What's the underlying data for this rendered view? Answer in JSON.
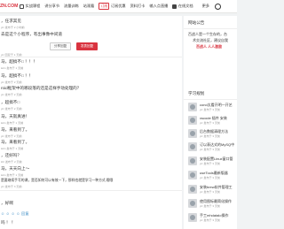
{
  "topbar": {
    "logo": "ZN.COM",
    "items": [
      {
        "label": "实战课程",
        "icon": "play-icon"
      },
      {
        "label": "讲分享节"
      },
      {
        "label": "流量训练"
      },
      {
        "label": "站观看"
      },
      {
        "label": "订阅优惠",
        "badge": "订阅"
      },
      {
        "label": "资料打卡"
      },
      {
        "label": "输入点直播"
      },
      {
        "label": "在线文档"
      }
    ],
    "more": "更多"
  },
  "left_items": [
    {
      "title": "，任求其见",
      "meta": "yiz 发布于 2 小时前"
    },
    {
      "title": "去是这个小程序，有出事像中间道",
      "meta": ""
    },
    {
      "title": "",
      "meta": "yiz 回复于 1 天前"
    },
    {
      "title": "马，超搞不□ ！！！",
      "meta": "lelin 发布于 1 天前"
    },
    {
      "title": "马，超搞不□ ！！",
      "meta": "yiz 发布于 2 天前"
    },
    {
      "title": "roid框架中的哪段落的还是这样手动处理的？",
      "meta": "yiz 发布于 2 天前"
    },
    {
      "title": "，超搞不□",
      "meta": "yiz 发布于 2 天前"
    },
    {
      "title": "马，天就真进！",
      "meta": "lelin 发布于 1 天前"
    },
    {
      "title": "马，来看到了。",
      "meta": "yiz 发布于 2 天前"
    },
    {
      "title": "马，来看到了。",
      "meta": "lelin 发布于 1 天前"
    },
    {
      "title": "，还好吗？",
      "meta": "ldz 发布于 2 天前"
    },
    {
      "title": "马，天天向上～",
      "meta": "lelin 发布于 1 天前"
    },
    {
      "title": "是要继续手写的课，是否如何可以有效一下，那样也就是学习一种方式,哦哦",
      "meta": "yiz 发布于 3 天前"
    },
    {
      "title": "，好啊",
      "meta": ""
    },
    {
      "title": "吗 ！ ！",
      "meta": ""
    }
  ],
  "buttons": {
    "share": "分享回复",
    "submit": "发表回复"
  },
  "reply_icons": "☺ ☺ ☺ ☺ 回复",
  "sidebar": {
    "about_title": "网站公告",
    "slogan1": "百战人是一个生存的，台",
    "slogan2": "术交流社区，建议自我",
    "slogan3": "百战人  人人激励",
    "plans_title": "学习规划",
    "plans": [
      {
        "title": "cond太看开明一开艺",
        "meta": "yiz 发布于 3 天前"
      },
      {
        "title": "xscode 插件 安装",
        "meta": "yiz 发布于 3 天前"
      },
      {
        "title": "后台数据清理方法",
        "meta": "yiz 发布于 3 天前"
      },
      {
        "title": "订以表达式的MySQ中",
        "meta": "yiz 发布于 3 天前"
      },
      {
        "title": "安装配置Linux窗口管",
        "meta": "yiz 发布于 3 天前"
      },
      {
        "title": "useTools最新版器",
        "meta": "yiz 发布于 3 天前"
      },
      {
        "title": "安装brew软件管理工",
        "meta": "yiz 发布于 3 天前"
      },
      {
        "title": "使用图标最简化操作",
        "meta": "yiz 发布于 3 天前"
      },
      {
        "title": "手工mhdatalo操作",
        "meta": "yiz 发布于 3 天前"
      }
    ]
  }
}
